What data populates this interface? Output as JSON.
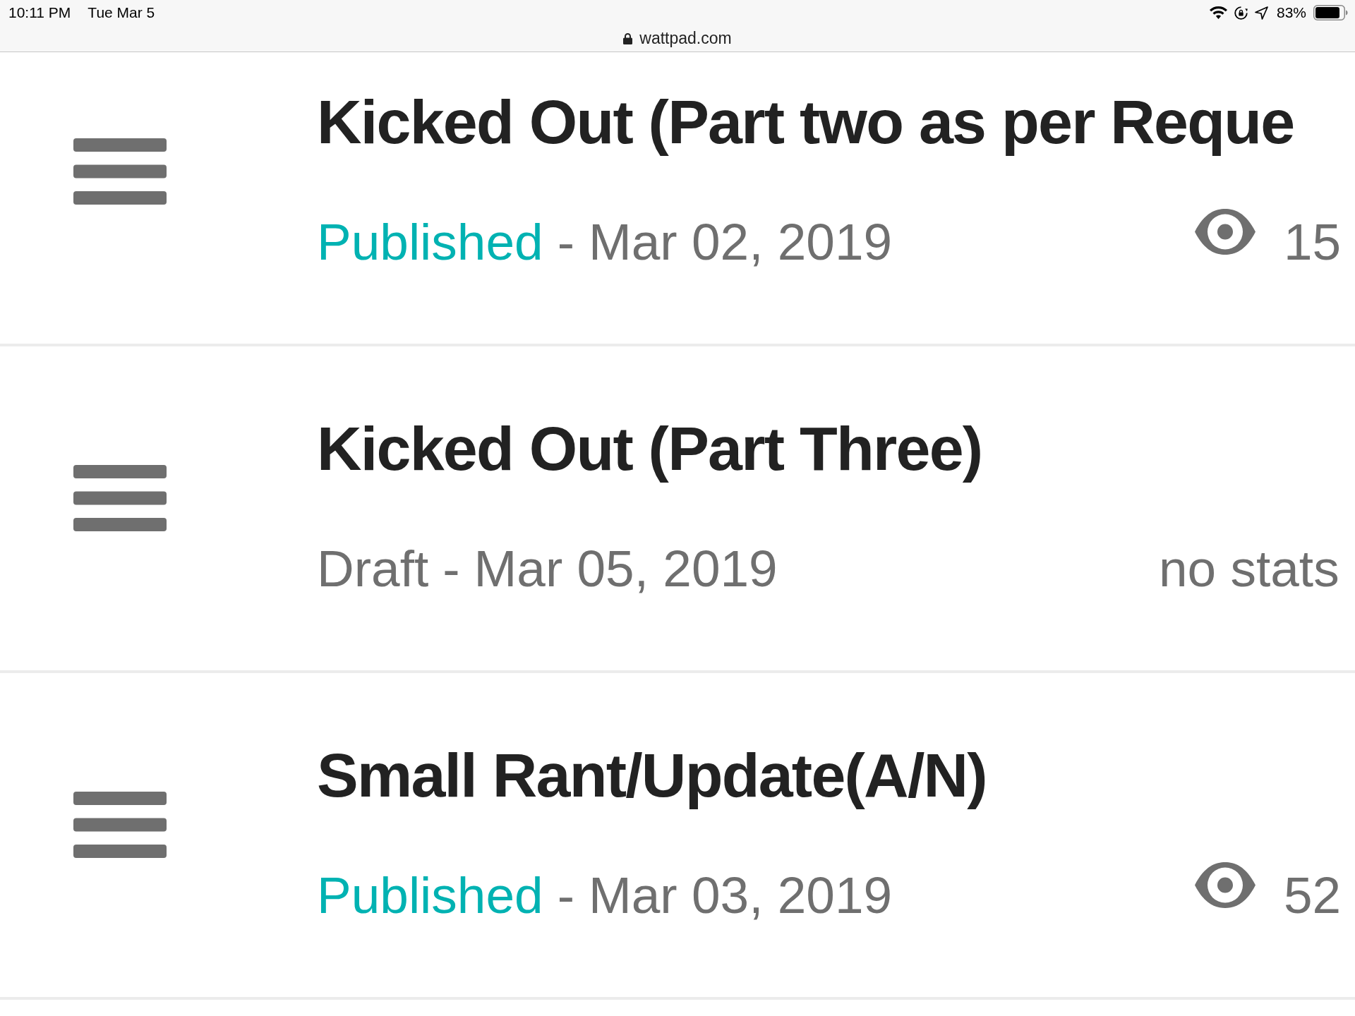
{
  "status_bar": {
    "time": "10:11 PM",
    "date": "Tue Mar 5",
    "battery_percent": "83%"
  },
  "address_bar": {
    "url": "wattpad.com"
  },
  "parts": [
    {
      "title": "Kicked Out (Part two as per Reque",
      "status": "Published",
      "published": true,
      "separator": "-",
      "date": "Mar 02, 2019",
      "stats": {
        "kind": "views",
        "count": "15"
      }
    },
    {
      "title": "Kicked Out (Part Three)",
      "status": "Draft",
      "published": false,
      "separator": "-",
      "date": "Mar 05, 2019",
      "stats": {
        "kind": "none",
        "text": "no stats"
      }
    },
    {
      "title": "Small Rant/Update(A/N)",
      "status": "Published",
      "published": true,
      "separator": "-",
      "date": "Mar 03, 2019",
      "stats": {
        "kind": "views",
        "count": "52"
      }
    }
  ]
}
